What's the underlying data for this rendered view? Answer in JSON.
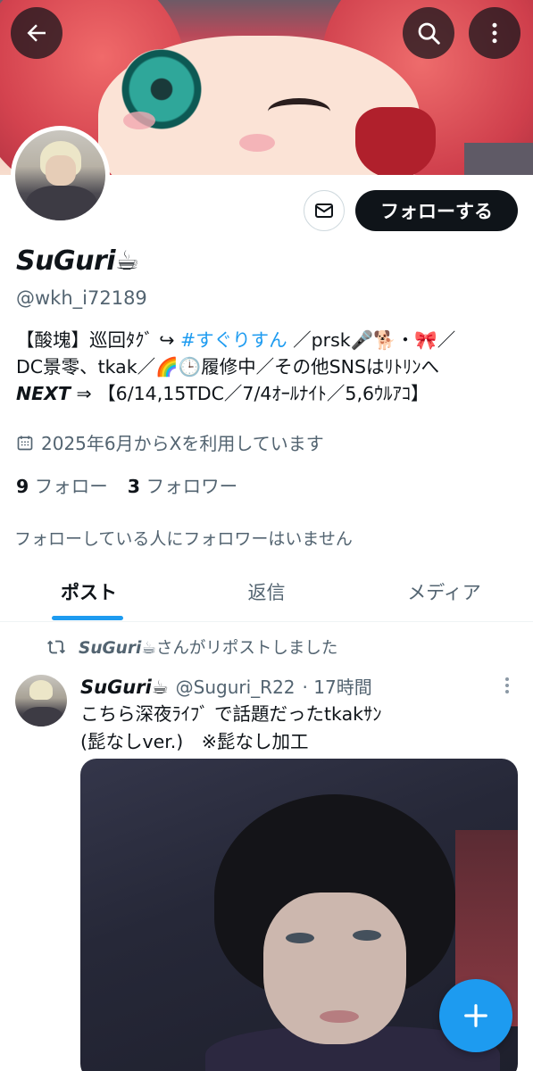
{
  "header": {
    "back_icon": "arrow-left-icon",
    "search_icon": "search-icon",
    "more_icon": "more-vertical-icon"
  },
  "profile": {
    "name": "SuGuri☕",
    "handle": "@wkh_i72189",
    "follow_label": "フォローする",
    "message_icon": "envelope-icon",
    "bio": {
      "line1_prefix": "【酸塊】巡回ﾀｸﾞ ↪ ",
      "hashtag": "#すぐりすん",
      "line1_suffix": " ／prsk🎤🐕・🎀／",
      "line2": "DC景零、tkak／🌈🕒履修中／その他SNSはﾘﾄﾘﾝへ",
      "line3_bold": "NEXT",
      "line3_rest": " ⇒ 【6/14,15TDC／7/4ｵｰﾙﾅｲﾄ／5,6ｳﾙｱｺ】"
    },
    "joined": "2025年6月からXを利用しています",
    "following_count": "9",
    "following_label": "フォロー",
    "followers_count": "3",
    "followers_label": "フォロワー",
    "followed_by_note": "フォローしている人にフォロワーはいません"
  },
  "tabs": [
    {
      "label": "ポスト",
      "active": true
    },
    {
      "label": "返信",
      "active": false
    },
    {
      "label": "メディア",
      "active": false
    }
  ],
  "post": {
    "repost_user": "SuGuri☕",
    "repost_suffix": "さんがリポストしました",
    "author_name": "SuGuri☕",
    "author_handle": "@Suguri_R22",
    "time": "· 17時間",
    "text_line1": "こちら深夜ﾗｲﾌﾞ で話題だったtkakｻﾝ",
    "text_line2": "(髭なしver.)　※髭なし加工"
  },
  "fab_icon": "plus-icon",
  "colors": {
    "accent": "#1d9bf0",
    "text": "#0f1419",
    "secondary_text": "#536471",
    "follow_button_bg": "#0f1419"
  }
}
